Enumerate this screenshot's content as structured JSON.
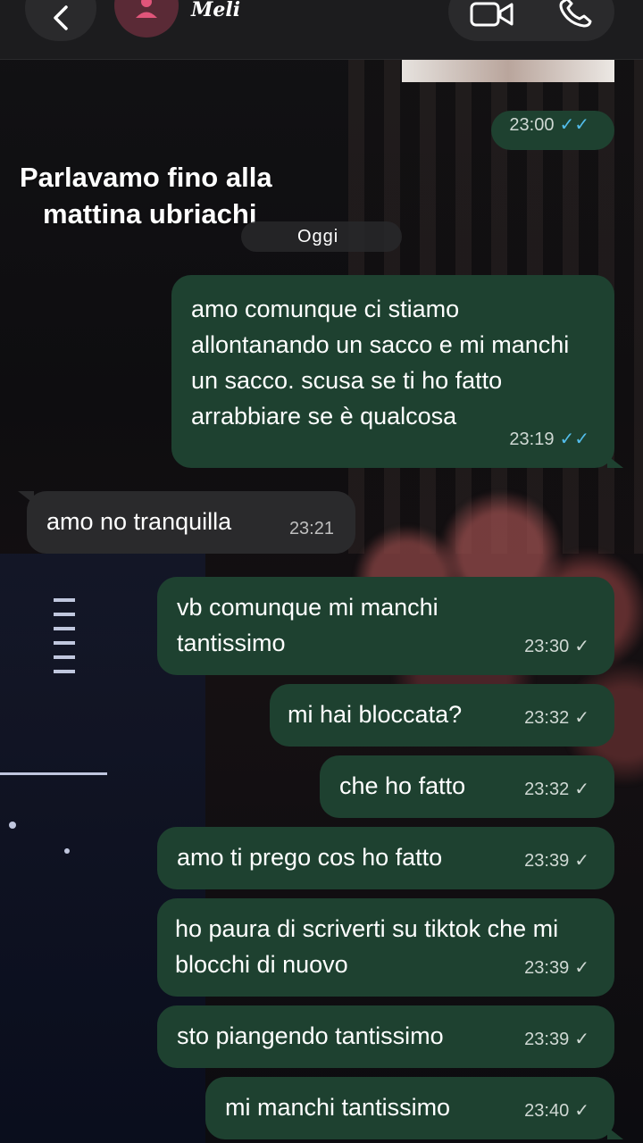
{
  "header": {
    "contact_name": "Meli",
    "icons": {
      "back": "chevron-left-icon",
      "avatar": "person-icon",
      "video": "video-camera-icon",
      "call": "phone-icon"
    }
  },
  "caption": {
    "line1": "Parlavamo fino alla",
    "line2": "mattina ubriachi"
  },
  "date_separator": "Oggi",
  "messages": [
    {
      "direction": "out",
      "text": "",
      "time": "23:00",
      "status": "read"
    },
    {
      "direction": "out",
      "text": "amo comunque ci stiamo allontanando un sacco e mi manchi un sacco. scusa se ti ho fatto arrabbiare se è qualcosa",
      "time": "23:19",
      "status": "read"
    },
    {
      "direction": "in",
      "text": "amo no tranquilla",
      "time": "23:21"
    },
    {
      "direction": "out",
      "text": "vb comunque mi manchi tantissimo",
      "time": "23:30",
      "status": "sent"
    },
    {
      "direction": "out",
      "text": "mi hai bloccata?",
      "time": "23:32",
      "status": "sent"
    },
    {
      "direction": "out",
      "text": "che ho fatto",
      "time": "23:32",
      "status": "sent"
    },
    {
      "direction": "out",
      "text": "amo ti prego cos ho fatto",
      "time": "23:39",
      "status": "sent"
    },
    {
      "direction": "out",
      "text": "ho paura di scriverti su tiktok che mi blocchi di nuovo",
      "time": "23:39",
      "status": "sent"
    },
    {
      "direction": "out",
      "text": "sto piangendo tantissimo",
      "time": "23:39",
      "status": "sent"
    },
    {
      "direction": "out",
      "text": "mi manchi tantissimo",
      "time": "23:40",
      "status": "sent"
    }
  ],
  "colors": {
    "outgoing_bubble": "#1e4130",
    "incoming_bubble": "#2a2a2c",
    "read_tick": "#53bdeb"
  }
}
